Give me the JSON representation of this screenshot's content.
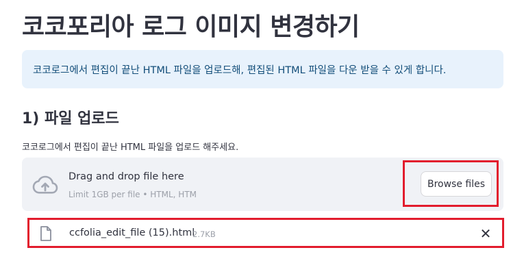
{
  "page": {
    "title": "코코포리아 로그 이미지 변경하기",
    "info_message": "코코로그에서 편집이 끝난 HTML 파일을 업로드해, 편집된 HTML 파일을 다운 받을 수 있게 합니다."
  },
  "upload_section": {
    "heading": "1) 파일 업로드",
    "label": "코코로그에서 편집이 끝난 HTML 파일을 업로드 해주세요.",
    "dropzone": {
      "icon": "cloud-upload-icon",
      "text": "Drag and drop file here",
      "hint": "Limit 1GB per file • HTML, HTM",
      "browse_label": "Browse files"
    },
    "uploaded_file": {
      "icon": "file-icon",
      "name": "ccfolia_edit_file (15).html",
      "size": "2.7KB",
      "remove_glyph": "✕"
    }
  },
  "colors": {
    "info_bg": "#e8f2fc",
    "info_text": "#124d79",
    "dropzone_bg": "#f0f2f6",
    "highlight": "#e21c2d"
  }
}
